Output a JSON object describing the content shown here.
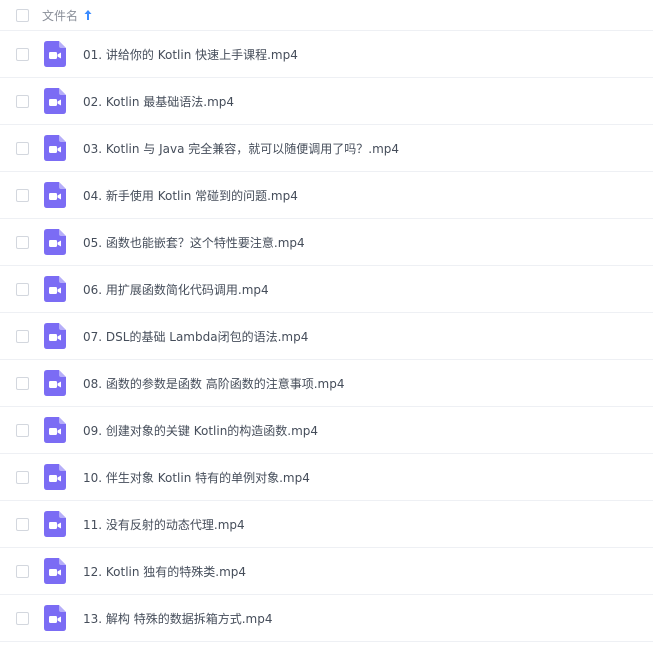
{
  "header": {
    "column_label": "文件名",
    "sort_icon": "arrow-up-icon",
    "accent_color": "#3b8cff"
  },
  "file_icon": {
    "name": "video-file-icon",
    "color": "#7b6cf4"
  },
  "files": [
    {
      "name": "01. 讲给你的 Kotlin 快速上手课程.mp4"
    },
    {
      "name": "02. Kotlin 最基础语法.mp4"
    },
    {
      "name": "03. Kotlin 与 Java 完全兼容，就可以随便调用了吗？.mp4"
    },
    {
      "name": "04. 新手使用 Kotlin 常碰到的问题.mp4"
    },
    {
      "name": "05. 函数也能嵌套？这个特性要注意.mp4"
    },
    {
      "name": "06. 用扩展函数简化代码调用.mp4"
    },
    {
      "name": "07. DSL的基础 Lambda闭包的语法.mp4"
    },
    {
      "name": "08. 函数的参数是函数 高阶函数的注意事项.mp4"
    },
    {
      "name": "09. 创建对象的关键 Kotlin的构造函数.mp4"
    },
    {
      "name": "10. 伴生对象 Kotlin 特有的单例对象.mp4"
    },
    {
      "name": "11. 没有反射的动态代理.mp4"
    },
    {
      "name": "12. Kotlin 独有的特殊类.mp4"
    },
    {
      "name": "13. 解构 特殊的数据拆箱方式.mp4"
    }
  ]
}
